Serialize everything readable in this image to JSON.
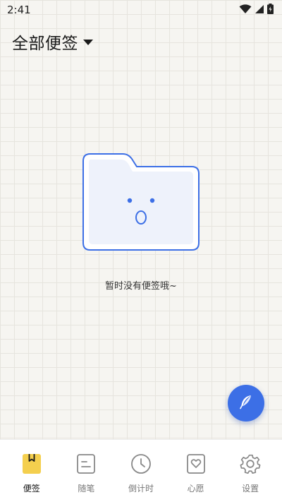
{
  "status_bar": {
    "time": "2:41",
    "icons": [
      "wifi-icon",
      "signal-icon",
      "battery-icon"
    ]
  },
  "header": {
    "title": "全部便签",
    "dropdown_icon": "caret-down-icon"
  },
  "empty_state": {
    "illustration": "surprised-folder-icon",
    "message": "暂时没有便签哦~"
  },
  "fab": {
    "icon": "feather-pen-icon"
  },
  "bottom_nav": {
    "active_index": 0,
    "items": [
      {
        "label": "便签",
        "icon": "bookmark-note-icon"
      },
      {
        "label": "随笔",
        "icon": "notebook-icon"
      },
      {
        "label": "倒计时",
        "icon": "clock-icon"
      },
      {
        "label": "心愿",
        "icon": "heart-box-icon"
      },
      {
        "label": "设置",
        "icon": "gear-icon"
      }
    ]
  },
  "colors": {
    "accent": "#3c6fe6",
    "active_tab": "#f4cf4e",
    "background": "#f6f5f1",
    "grid_line": "#e6e4de",
    "icon_gray": "#888888"
  }
}
